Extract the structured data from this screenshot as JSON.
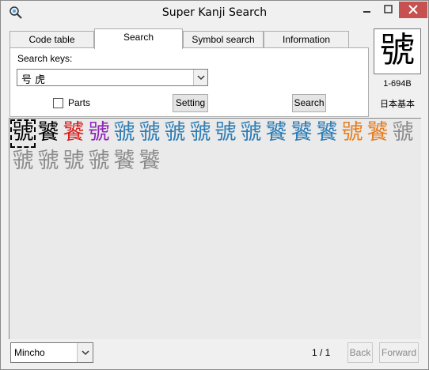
{
  "window": {
    "title": "Super Kanji Search"
  },
  "tabs": [
    {
      "label": "Code table",
      "active": false
    },
    {
      "label": "Search",
      "active": true
    },
    {
      "label": "Symbol search",
      "active": false
    },
    {
      "label": "Information",
      "active": false
    }
  ],
  "search": {
    "keys_label": "Search keys:",
    "keys_value": "号 虎",
    "parts_label": "Parts",
    "parts_checked": false,
    "setting_label": "Setting",
    "search_label": "Search"
  },
  "preview": {
    "char": "號",
    "code": "1-694B",
    "standard": "日本基本"
  },
  "results": [
    {
      "char": "號",
      "color": "#000000",
      "selected": true
    },
    {
      "char": "饕",
      "color": "#000000"
    },
    {
      "char": "饕",
      "color": "#d8211f"
    },
    {
      "char": "號",
      "color": "#8e24b8"
    },
    {
      "char": "虢",
      "color": "#2f7db5"
    },
    {
      "char": "虢",
      "color": "#2f7db5"
    },
    {
      "char": "虢",
      "color": "#2f7db5"
    },
    {
      "char": "虢",
      "color": "#2f7db5"
    },
    {
      "char": "號",
      "color": "#2f7db5"
    },
    {
      "char": "虢",
      "color": "#2f7db5"
    },
    {
      "char": "饕",
      "color": "#2f7db5"
    },
    {
      "char": "饕",
      "color": "#2f7db5"
    },
    {
      "char": "饕",
      "color": "#2f7db5"
    },
    {
      "char": "號",
      "color": "#e67e22"
    },
    {
      "char": "饕",
      "color": "#e67e22"
    },
    {
      "char": "虢",
      "color": "#8c8c8c"
    },
    {
      "char": "虢",
      "color": "#8c8c8c"
    },
    {
      "char": "虢",
      "color": "#8c8c8c"
    },
    {
      "char": "號",
      "color": "#8c8c8c"
    },
    {
      "char": "虢",
      "color": "#8c8c8c"
    },
    {
      "char": "饕",
      "color": "#8c8c8c"
    },
    {
      "char": "饕",
      "color": "#8c8c8c"
    }
  ],
  "status": {
    "font": "Mincho",
    "page": "1 / 1",
    "back_label": "Back",
    "forward_label": "Forward"
  }
}
